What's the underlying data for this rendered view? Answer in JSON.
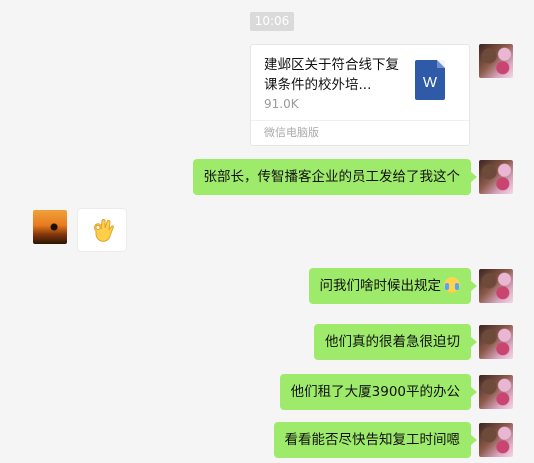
{
  "chat": {
    "time": "10:06",
    "file_card": {
      "name": "建邺区关于符合线下复课条件的校外培...",
      "size": "91.0K",
      "icon_letter": "W",
      "footer": "微信电脑版"
    },
    "messages": [
      {
        "text": "张部长，传智播客企业的员工发给了我这个"
      },
      {
        "text": "问我们啥时候出规定"
      },
      {
        "text": "他们真的很着急很迫切"
      },
      {
        "text": "他们租了大厦3900平的办公"
      },
      {
        "text": "看看能否尽快告知复工时间嗯"
      }
    ],
    "colors": {
      "sent_bubble": "#9eea6a",
      "background": "#f5f5f5",
      "word_icon": "#2e5aa7"
    }
  }
}
